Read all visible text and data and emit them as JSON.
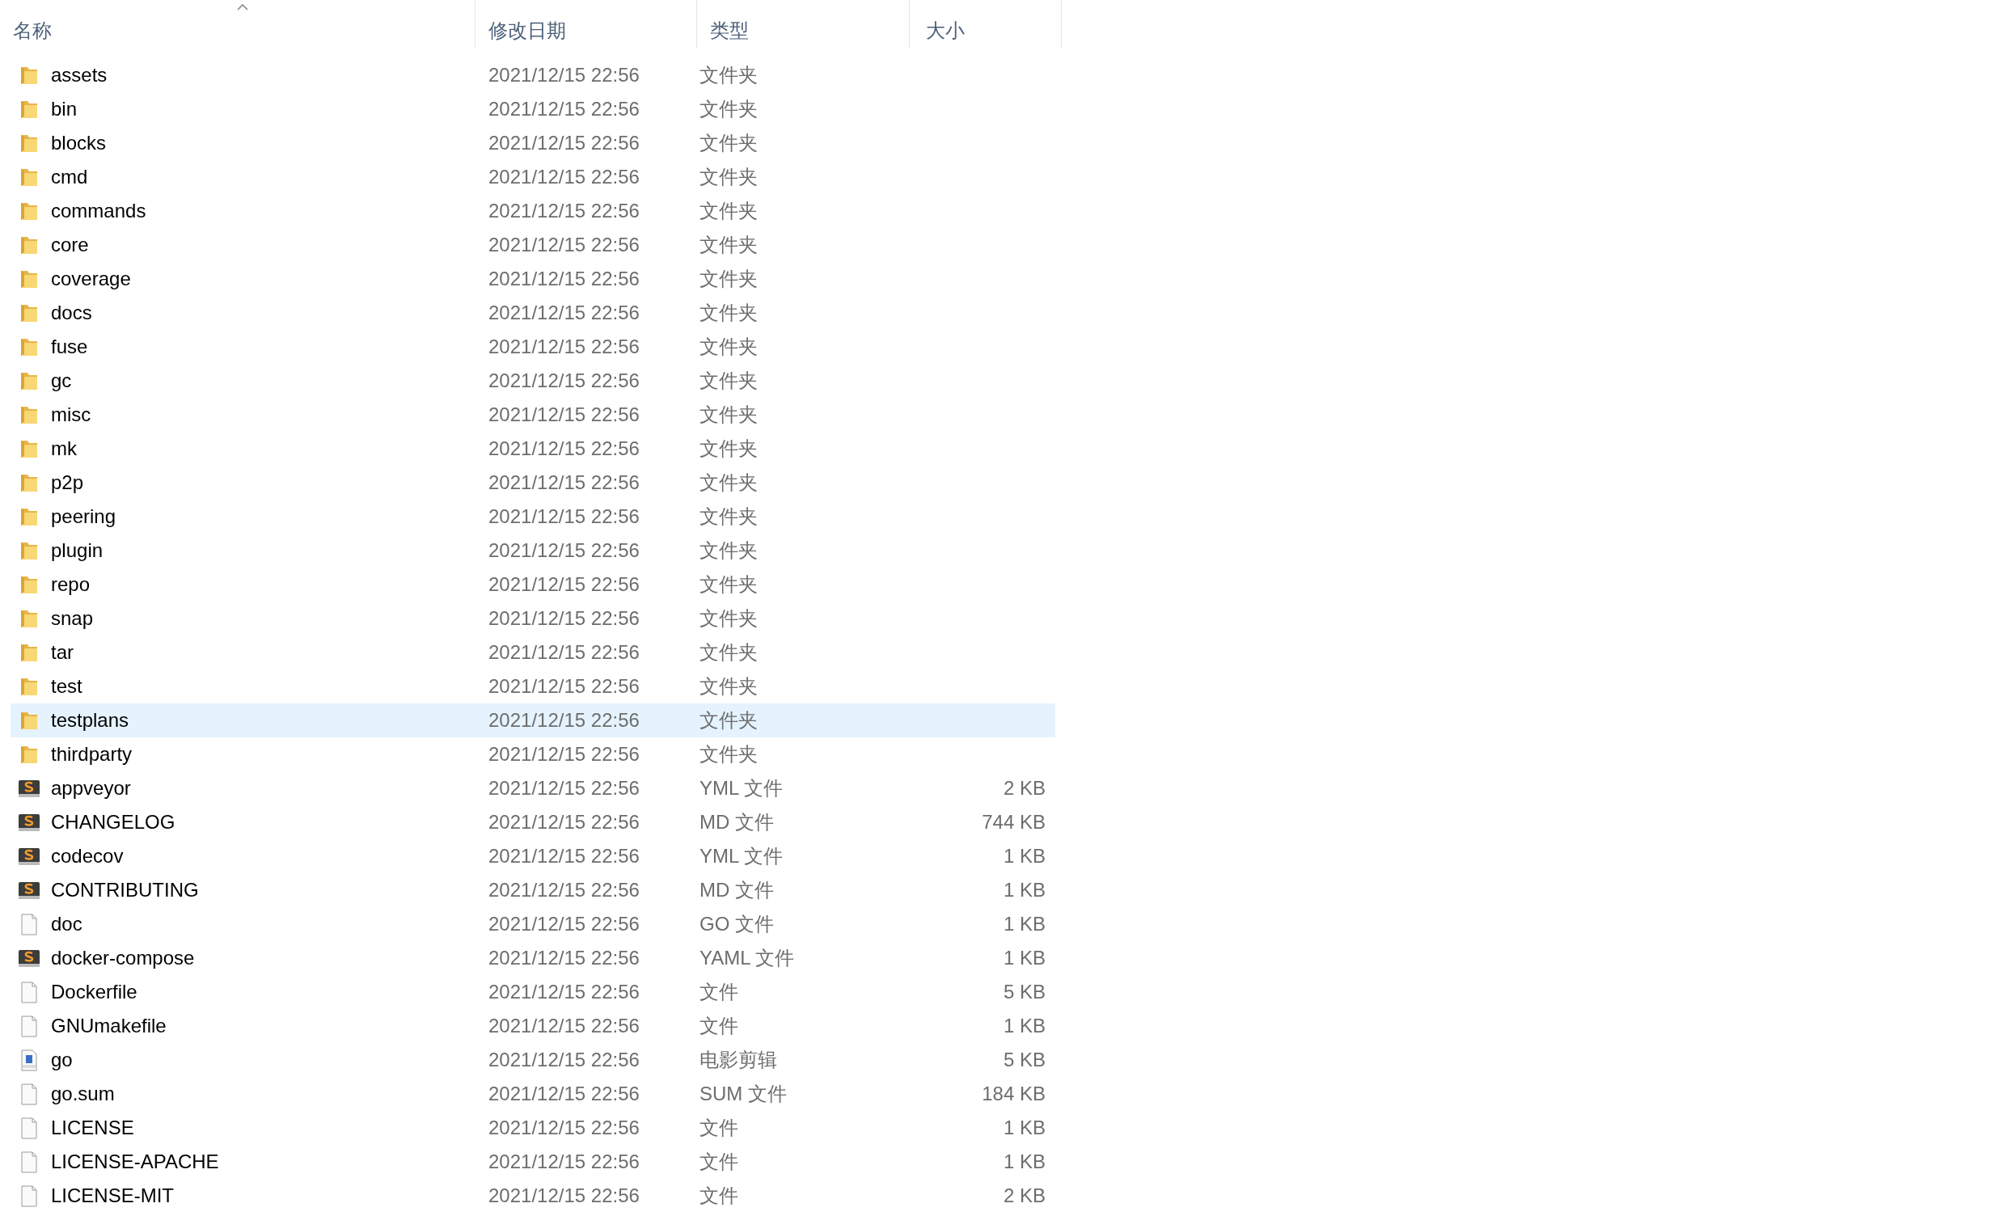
{
  "columns": [
    {
      "label": "名称",
      "sorted": true
    },
    {
      "label": "修改日期",
      "sorted": false
    },
    {
      "label": "类型",
      "sorted": false
    },
    {
      "label": "大小",
      "sorted": false
    }
  ],
  "rows": [
    {
      "kind": "folder",
      "name": "assets",
      "modified": "2021/12/15 22:56",
      "type": "文件夹",
      "selected": false
    },
    {
      "kind": "folder",
      "name": "bin",
      "modified": "2021/12/15 22:56",
      "type": "文件夹",
      "selected": false
    },
    {
      "kind": "folder",
      "name": "blocks",
      "modified": "2021/12/15 22:56",
      "type": "文件夹",
      "selected": false
    },
    {
      "kind": "folder",
      "name": "cmd",
      "modified": "2021/12/15 22:56",
      "type": "文件夹",
      "selected": false
    },
    {
      "kind": "folder",
      "name": "commands",
      "modified": "2021/12/15 22:56",
      "type": "文件夹",
      "selected": false
    },
    {
      "kind": "folder",
      "name": "core",
      "modified": "2021/12/15 22:56",
      "type": "文件夹",
      "selected": false
    },
    {
      "kind": "folder",
      "name": "coverage",
      "modified": "2021/12/15 22:56",
      "type": "文件夹",
      "selected": false
    },
    {
      "kind": "folder",
      "name": "docs",
      "modified": "2021/12/15 22:56",
      "type": "文件夹",
      "selected": false
    },
    {
      "kind": "folder",
      "name": "fuse",
      "modified": "2021/12/15 22:56",
      "type": "文件夹",
      "selected": false
    },
    {
      "kind": "folder",
      "name": "gc",
      "modified": "2021/12/15 22:56",
      "type": "文件夹",
      "selected": false
    },
    {
      "kind": "folder",
      "name": "misc",
      "modified": "2021/12/15 22:56",
      "type": "文件夹",
      "selected": false
    },
    {
      "kind": "folder",
      "name": "mk",
      "modified": "2021/12/15 22:56",
      "type": "文件夹",
      "selected": false
    },
    {
      "kind": "folder",
      "name": "p2p",
      "modified": "2021/12/15 22:56",
      "type": "文件夹",
      "selected": false
    },
    {
      "kind": "folder",
      "name": "peering",
      "modified": "2021/12/15 22:56",
      "type": "文件夹",
      "selected": false
    },
    {
      "kind": "folder",
      "name": "plugin",
      "modified": "2021/12/15 22:56",
      "type": "文件夹",
      "selected": false
    },
    {
      "kind": "folder",
      "name": "repo",
      "modified": "2021/12/15 22:56",
      "type": "文件夹",
      "selected": false
    },
    {
      "kind": "folder",
      "name": "snap",
      "modified": "2021/12/15 22:56",
      "type": "文件夹",
      "selected": false
    },
    {
      "kind": "folder",
      "name": "tar",
      "modified": "2021/12/15 22:56",
      "type": "文件夹",
      "selected": false
    },
    {
      "kind": "folder",
      "name": "test",
      "modified": "2021/12/15 22:56",
      "type": "文件夹",
      "selected": false
    },
    {
      "kind": "folder",
      "name": "testplans",
      "modified": "2021/12/15 22:56",
      "type": "文件夹",
      "selected": true
    },
    {
      "kind": "folder",
      "name": "thirdparty",
      "modified": "2021/12/15 22:56",
      "type": "文件夹",
      "selected": false
    },
    {
      "kind": "editor",
      "name": "appveyor",
      "modified": "2021/12/15 22:56",
      "type": "YML 文件",
      "size": "2 KB",
      "selected": false
    },
    {
      "kind": "editor",
      "name": "CHANGELOG",
      "modified": "2021/12/15 22:56",
      "type": "MD 文件",
      "size": "744 KB",
      "selected": false
    },
    {
      "kind": "editor",
      "name": "codecov",
      "modified": "2021/12/15 22:56",
      "type": "YML 文件",
      "size": "1 KB",
      "selected": false
    },
    {
      "kind": "editor",
      "name": "CONTRIBUTING",
      "modified": "2021/12/15 22:56",
      "type": "MD 文件",
      "size": "1 KB",
      "selected": false
    },
    {
      "kind": "blank",
      "name": "doc",
      "modified": "2021/12/15 22:56",
      "type": "GO 文件",
      "size": "1 KB",
      "selected": false
    },
    {
      "kind": "editor",
      "name": "docker-compose",
      "modified": "2021/12/15 22:56",
      "type": "YAML 文件",
      "size": "1 KB",
      "selected": false
    },
    {
      "kind": "blank",
      "name": "Dockerfile",
      "modified": "2021/12/15 22:56",
      "type": "文件",
      "size": "5 KB",
      "selected": false
    },
    {
      "kind": "blank",
      "name": "GNUmakefile",
      "modified": "2021/12/15 22:56",
      "type": "文件",
      "size": "1 KB",
      "selected": false
    },
    {
      "kind": "video",
      "name": "go",
      "modified": "2021/12/15 22:56",
      "type": "电影剪辑",
      "size": "5 KB",
      "selected": false
    },
    {
      "kind": "blank",
      "name": "go.sum",
      "modified": "2021/12/15 22:56",
      "type": "SUM 文件",
      "size": "184 KB",
      "selected": false
    },
    {
      "kind": "blank",
      "name": "LICENSE",
      "modified": "2021/12/15 22:56",
      "type": "文件",
      "size": "1 KB",
      "selected": false
    },
    {
      "kind": "blank",
      "name": "LICENSE-APACHE",
      "modified": "2021/12/15 22:56",
      "type": "文件",
      "size": "1 KB",
      "selected": false
    },
    {
      "kind": "blank",
      "name": "LICENSE-MIT",
      "modified": "2021/12/15 22:56",
      "type": "文件",
      "size": "2 KB",
      "selected": false
    }
  ]
}
